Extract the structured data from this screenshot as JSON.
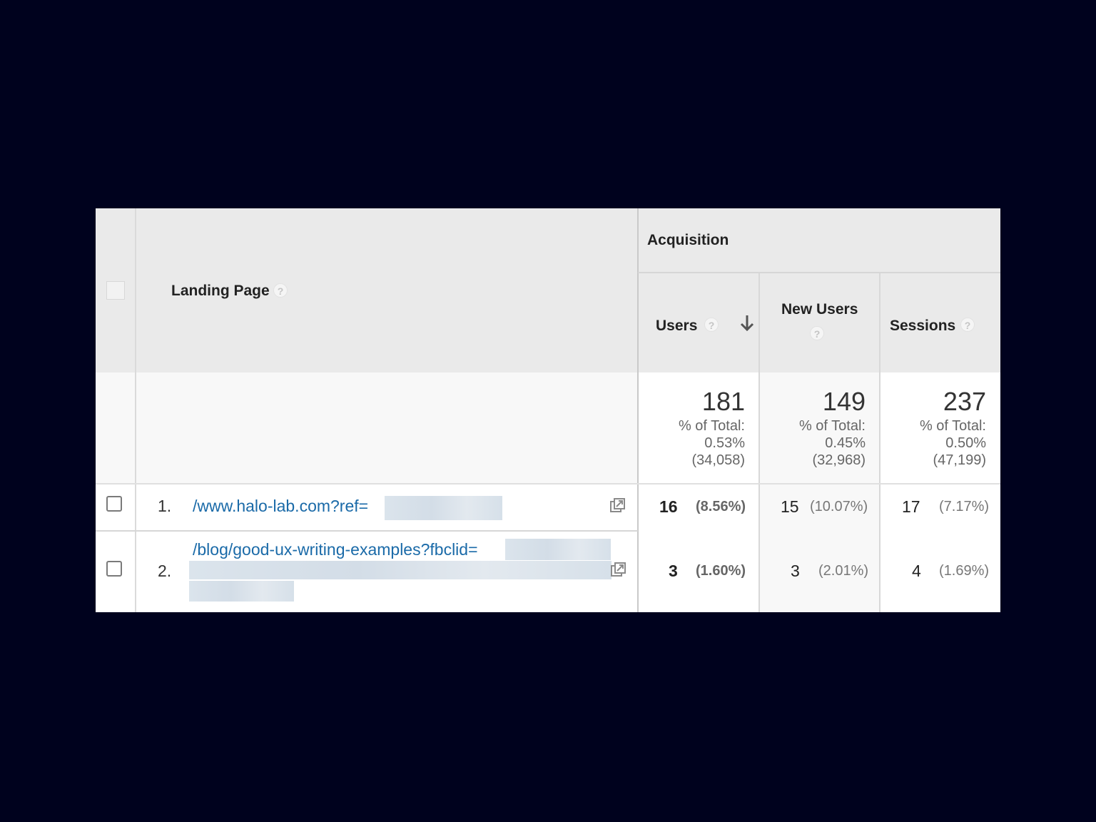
{
  "table": {
    "group_header": "Acquisition",
    "columns": {
      "landing_page": "Landing Page",
      "users": "Users",
      "new_users": "New Users",
      "sessions": "Sessions",
      "help_glyph": "?"
    },
    "sort": {
      "column": "users",
      "direction": "descending",
      "icon": "arrow-down-icon"
    },
    "totals": {
      "users": {
        "value": "181",
        "label": "% of Total:",
        "percent": "0.53%",
        "overall": "(34,058)"
      },
      "new_users": {
        "value": "149",
        "label": "% of Total:",
        "percent": "0.45%",
        "overall": "(32,968)"
      },
      "sessions": {
        "value": "237",
        "label": "% of Total:",
        "percent": "0.50%",
        "overall": "(47,199)"
      }
    },
    "rows": [
      {
        "index": "1.",
        "landing_page": "/www.halo-lab.com?ref=",
        "users": "16",
        "users_pct": "(8.56%)",
        "new_users": "15",
        "new_users_pct": "(10.07%)",
        "sessions": "17",
        "sessions_pct": "(7.17%)"
      },
      {
        "index": "2.",
        "landing_page": "/blog/good-ux-writing-examples?fbclid=",
        "users": "3",
        "users_pct": "(1.60%)",
        "new_users": "3",
        "new_users_pct": "(2.01%)",
        "sessions": "4",
        "sessions_pct": "(1.69%)"
      }
    ]
  },
  "colors": {
    "background": "#00021e",
    "header": "#eaeaea",
    "summary": "#f8f8f8",
    "link": "#1a6aa8",
    "redaction": "#d6e0e9"
  },
  "icons": {
    "help": "help-icon",
    "external_link": "external-link-icon",
    "sort": "arrow-down-icon"
  }
}
